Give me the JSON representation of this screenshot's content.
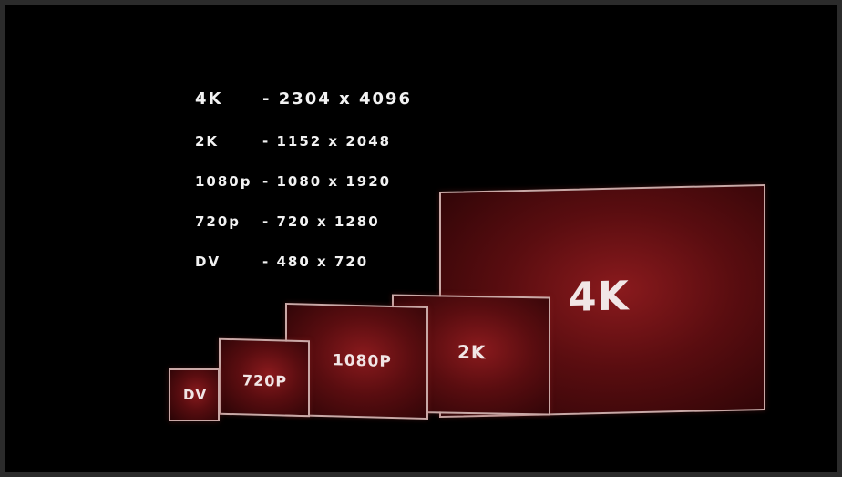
{
  "specs": [
    {
      "format": "4K",
      "resolution": "- 2304 x 4096"
    },
    {
      "format": "2K",
      "resolution": "- 1152 x 2048"
    },
    {
      "format": "1080p",
      "resolution": "- 1080 x 1920"
    },
    {
      "format": "720p",
      "resolution": "- 720 x 1280"
    },
    {
      "format": "DV",
      "resolution": "- 480 x 720"
    }
  ],
  "screens": [
    {
      "label": "DV"
    },
    {
      "label": "720P"
    },
    {
      "label": "1080P"
    },
    {
      "label": "2K"
    },
    {
      "label": "4K"
    }
  ],
  "colors": {
    "background": "#000000",
    "screen_fill": "#5a0d10",
    "screen_border": "#c9a8a6",
    "text": "#f2f2f2"
  }
}
